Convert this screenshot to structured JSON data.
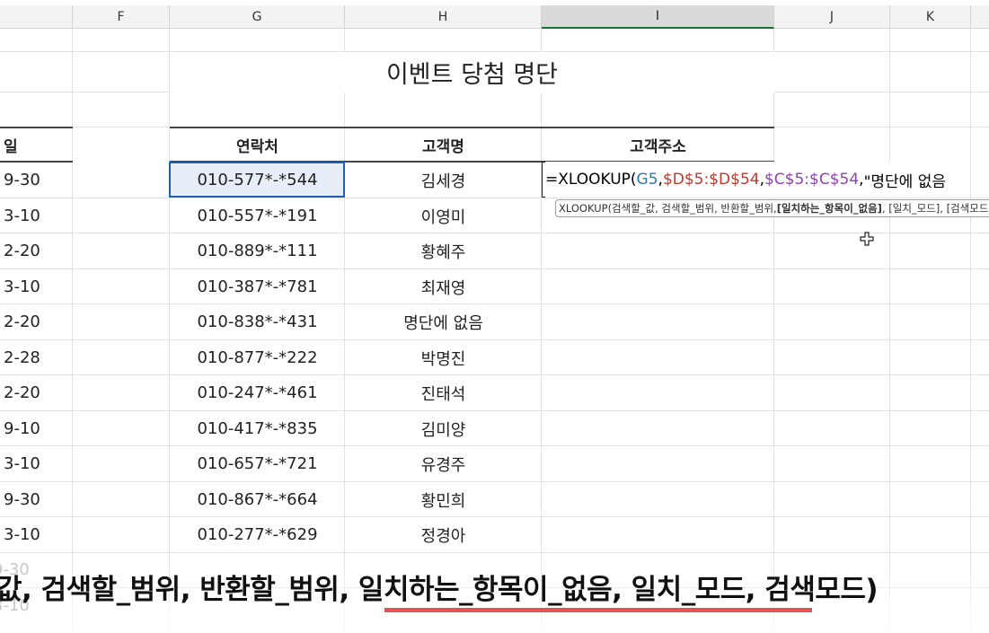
{
  "columns": [
    "F",
    "G",
    "H",
    "I",
    "J",
    "K"
  ],
  "title": "이벤트 당첨 명단",
  "headers": {
    "date_partial": "일",
    "contact": "연락처",
    "customer_name": "고객명",
    "customer_address": "고객주소"
  },
  "rows": [
    {
      "date": "9-30",
      "contact": "010-577*-*544",
      "name": "김세경"
    },
    {
      "date": "3-10",
      "contact": "010-557*-*191",
      "name": "이영미"
    },
    {
      "date": "2-20",
      "contact": "010-889*-*111",
      "name": "황혜주"
    },
    {
      "date": "3-10",
      "contact": "010-387*-*781",
      "name": "최재영"
    },
    {
      "date": "2-20",
      "contact": "010-838*-*431",
      "name": "명단에 없음"
    },
    {
      "date": "2-28",
      "contact": "010-877*-*222",
      "name": "박명진"
    },
    {
      "date": "2-20",
      "contact": "010-247*-*461",
      "name": "진태석"
    },
    {
      "date": "9-10",
      "contact": "010-417*-*835",
      "name": "김미양"
    },
    {
      "date": "3-10",
      "contact": "010-657*-*721",
      "name": "유경주"
    },
    {
      "date": "9-30",
      "contact": "010-867*-*664",
      "name": "황민희"
    },
    {
      "date": "3-10",
      "contact": "010-277*-*629",
      "name": "정경아"
    }
  ],
  "faint_rows": [
    "9-30",
    "3-10"
  ],
  "formula": {
    "prefix": "=XLOOKUP(",
    "arg1": "G5",
    "sep1": ",",
    "arg2": "$D$5:$D$54",
    "sep2": ",",
    "arg3": "$C$5:$C$54",
    "sep3": ",",
    "arg4": "\"명단에 없음"
  },
  "tooltip": {
    "plain": "XLOOKUP(검색할_값, 검색할_범위, 반환할_범위, ",
    "bold": "[일치하는_항목이_없음]",
    "rest": ", [일치_모드], [검색모드])"
  },
  "caption": "값, 검색할_범위, 반환할_범위, 일치하는_항목이_없음, 일치_모드, 검색모드)",
  "colors": {
    "accent_green": "#137333",
    "selection_blue": "#1f5fb8",
    "underline_red": "#e25555",
    "formula_g": "#2d7aa6",
    "formula_d": "#c0392b",
    "formula_c": "#8e44ad"
  }
}
